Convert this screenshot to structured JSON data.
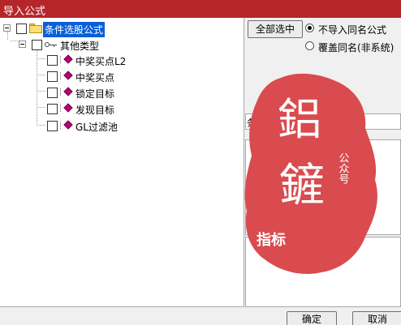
{
  "window": {
    "title": "导入公式"
  },
  "tree": {
    "root": {
      "label": "条件选股公式"
    },
    "group": {
      "label": "其他类型"
    },
    "items": [
      {
        "label": "中奖买点L2"
      },
      {
        "label": "中奖买点"
      },
      {
        "label": "锁定目标"
      },
      {
        "label": "发现目标"
      },
      {
        "label": "GL过滤池"
      }
    ]
  },
  "controls": {
    "select_all_label": "全部选中",
    "radio_options": [
      {
        "label": "不导入同名公式",
        "selected": true
      },
      {
        "label": "覆盖同名(非系统)",
        "selected": false
      }
    ]
  },
  "info": {
    "label": "条件选股公式"
  },
  "footer": {
    "ok_label": "确定",
    "cancel_label": "取消"
  },
  "watermark": {
    "glyph_1": "鋁",
    "glyph_2": "鏟",
    "side_text": "公众号",
    "bottom_text": "指标"
  },
  "colors": {
    "titlebar": "#b5262b",
    "selection": "#0a5fd8",
    "seal": "#d94b4e"
  }
}
